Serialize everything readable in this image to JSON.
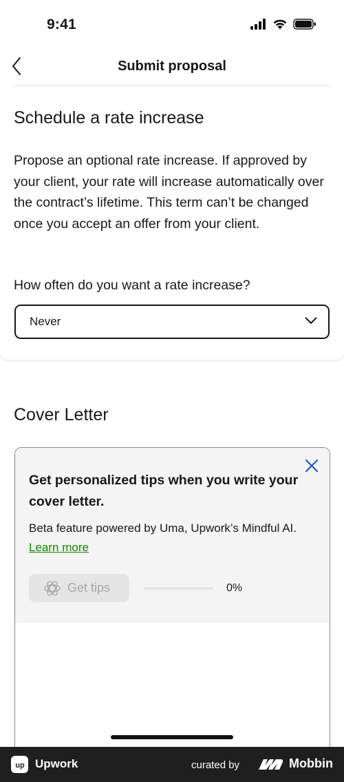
{
  "status_bar": {
    "time": "9:41"
  },
  "nav": {
    "title": "Submit proposal"
  },
  "rate": {
    "title": "Schedule a rate increase",
    "description": "Propose an optional rate increase. If approved by your client, your rate will increase automatically over the contract’s lifetime. This term can’t be changed once you accept an offer from your client.",
    "question": "How often do you want a rate increase?",
    "selected": "Never"
  },
  "cover": {
    "title": "Cover Letter",
    "tips_heading": "Get personalized tips when you write your cover letter.",
    "tips_text": "Beta feature powered by Uma, Upwork’s Mindful AI.",
    "tips_link": "Learn more",
    "tips_button": "Get tips",
    "progress": 0,
    "progress_label": "0%"
  },
  "footer": {
    "logo_text": "up",
    "app_name": "Upwork",
    "curated_by": "curated by",
    "brand": "Mobbin"
  },
  "colors": {
    "accent": "#108a00",
    "close": "#1f57c3",
    "footer_bg": "#1f1f1f"
  }
}
